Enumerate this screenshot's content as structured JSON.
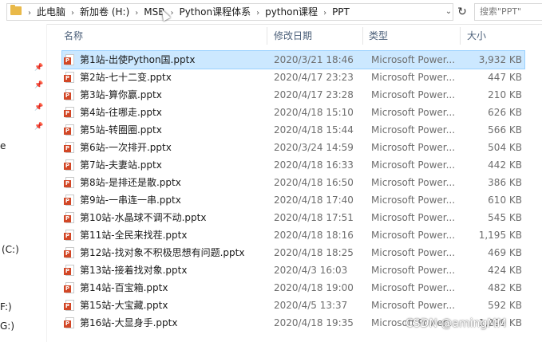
{
  "address_bar": {
    "crumbs": [
      "此电脑",
      "新加卷 (H:)",
      "MSB",
      "Python课程体系",
      "python课程",
      "PPT"
    ],
    "search_placeholder": "搜索\"PPT\""
  },
  "nav": {
    "partial_labels": [
      "e",
      "(C:)",
      "F:)",
      "G:)"
    ]
  },
  "columns": {
    "name": "名称",
    "date": "修改日期",
    "type": "类型",
    "size": "大小"
  },
  "files": [
    {
      "name": "第1站-出使Python国.pptx",
      "date": "2020/3/21 18:46",
      "type": "Microsoft Power...",
      "size": "3,932 KB",
      "selected": true
    },
    {
      "name": "第2站-七十二变.pptx",
      "date": "2020/4/17 23:23",
      "type": "Microsoft Power...",
      "size": "447 KB"
    },
    {
      "name": "第3站-算你赢.pptx",
      "date": "2020/4/17 23:28",
      "type": "Microsoft Power...",
      "size": "210 KB"
    },
    {
      "name": "第4站-往哪走.pptx",
      "date": "2020/4/18 15:10",
      "type": "Microsoft Power...",
      "size": "626 KB"
    },
    {
      "name": "第5站-转圈圈.pptx",
      "date": "2020/4/18 15:44",
      "type": "Microsoft Power...",
      "size": "566 KB"
    },
    {
      "name": "第6站-一次排开.pptx",
      "date": "2020/3/24 14:59",
      "type": "Microsoft Power...",
      "size": "504 KB"
    },
    {
      "name": "第7站-夫妻站.pptx",
      "date": "2020/4/18 16:33",
      "type": "Microsoft Power...",
      "size": "442 KB"
    },
    {
      "name": "第8站-是排还是散.pptx",
      "date": "2020/4/18 16:50",
      "type": "Microsoft Power...",
      "size": "386 KB"
    },
    {
      "name": "第9站-一串连一串.pptx",
      "date": "2020/4/18 17:40",
      "type": "Microsoft Power...",
      "size": "610 KB"
    },
    {
      "name": "第10站-水晶球不调不动.pptx",
      "date": "2020/4/18 17:51",
      "type": "Microsoft Power...",
      "size": "545 KB"
    },
    {
      "name": "第11站-全民来找茬.pptx",
      "date": "2020/4/18 18:16",
      "type": "Microsoft Power...",
      "size": "1,195 KB"
    },
    {
      "name": "第12站-找对象不积极思想有问题.pptx",
      "date": "2020/4/18 18:25",
      "type": "Microsoft Power...",
      "size": "469 KB"
    },
    {
      "name": "第13站-接着找对象.pptx",
      "date": "2020/4/3 16:03",
      "type": "Microsoft Power...",
      "size": "424 KB"
    },
    {
      "name": "第14站-百宝箱.pptx",
      "date": "2020/4/18 19:00",
      "type": "Microsoft Power...",
      "size": "482 KB"
    },
    {
      "name": "第15站-大宝藏.pptx",
      "date": "2020/4/5 13:37",
      "type": "Microsoft Power...",
      "size": "592 KB"
    },
    {
      "name": "第16站-大显身手.pptx",
      "date": "2020/4/18 19:35",
      "type": "Microsoft Power...",
      "size": "1,299 KB"
    }
  ],
  "watermark": "CSDN @amingMM",
  "colors": {
    "selected_bg": "#cce8ff",
    "header_text": "#4c607a",
    "ppt_icon": "#d24726",
    "folder_icon": "#e9b949"
  }
}
